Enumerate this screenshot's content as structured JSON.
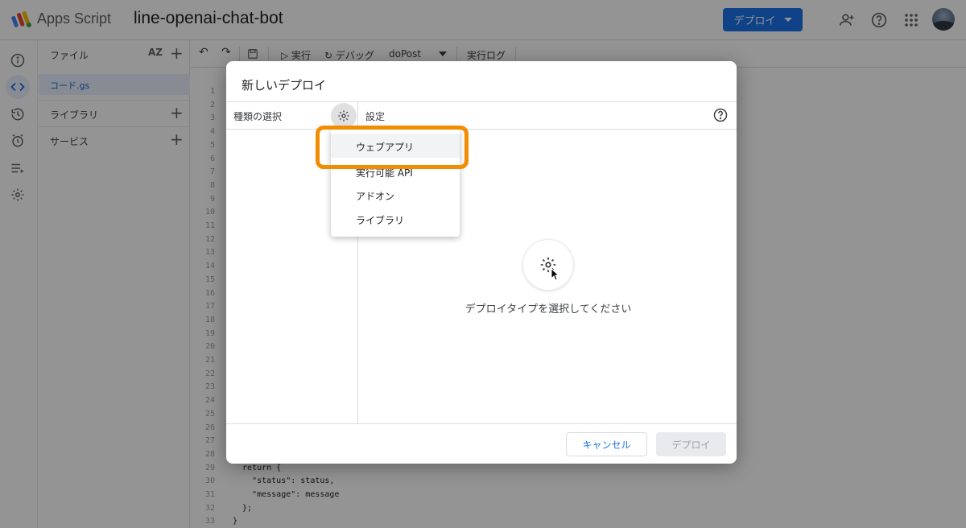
{
  "header": {
    "app_name": "Apps Script",
    "project_name": "line-openai-chat-bot",
    "deploy_label": "デプロイ"
  },
  "files": {
    "title": "ファイル",
    "sort_label": "AZ",
    "file_name": "コード.gs",
    "libraries_label": "ライブラリ",
    "services_label": "サービス"
  },
  "toolbar": {
    "run_label": "実行",
    "debug_label": "デバッグ",
    "function_name": "doPost",
    "log_label": "実行ログ"
  },
  "editor": {
    "line_numbers": [
      "1",
      "2",
      "3",
      "4",
      "5",
      "6",
      "7",
      "8",
      "9",
      "10",
      "11",
      "12",
      "13",
      "14",
      "15",
      "16",
      "17",
      "18",
      "19",
      "20",
      "21",
      "22",
      "23",
      "24",
      "25",
      "26",
      "27",
      "28",
      "29",
      "30",
      "31",
      "32",
      "33"
    ],
    "code_lines": [
      "  return {",
      "    \"status\": status,",
      "    \"message\": message",
      "  };",
      "}"
    ]
  },
  "dialog": {
    "title": "新しいデプロイ",
    "type_label": "種類の選択",
    "settings_label": "設定",
    "prompt": "デプロイタイプを選択してください",
    "cancel_label": "キャンセル",
    "deploy_label": "デプロイ"
  },
  "menu": {
    "items": [
      "ウェブアプリ",
      "実行可能 API",
      "アドオン",
      "ライブラリ"
    ],
    "highlighted_index": 0,
    "highlight_color": "#f28c00"
  },
  "colors": {
    "accent": "#1a73e8"
  }
}
